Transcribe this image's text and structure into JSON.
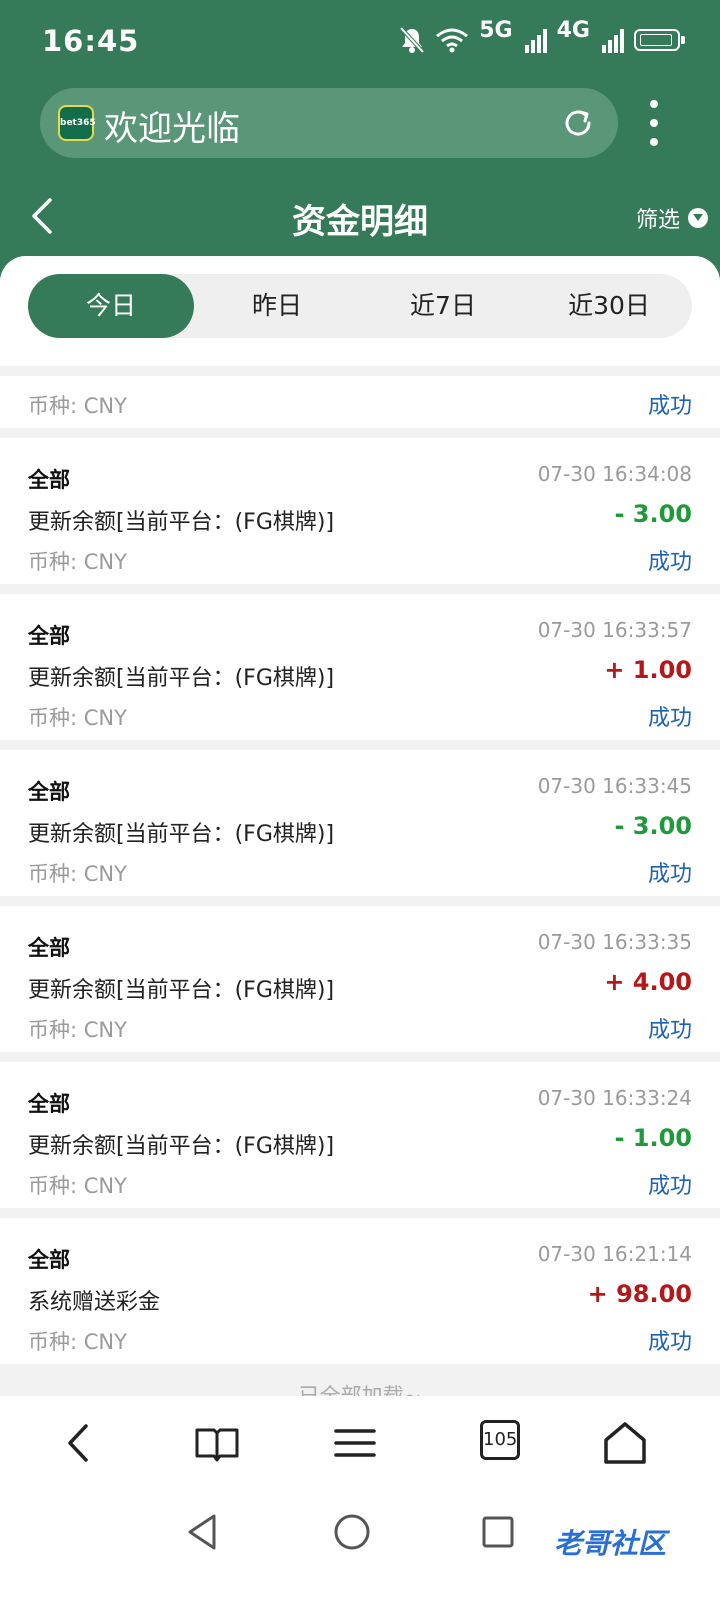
{
  "status_bar": {
    "time": "16:45",
    "net1": "5G",
    "net2": "4G"
  },
  "browser": {
    "site_title": "欢迎光临",
    "logo_text": "bet365",
    "tab_count": "105"
  },
  "header": {
    "title": "资金明细",
    "filter_label": "筛选"
  },
  "tabs": [
    {
      "label": "今日",
      "active": true
    },
    {
      "label": "昨日",
      "active": false
    },
    {
      "label": "近7日",
      "active": false
    },
    {
      "label": "近30日",
      "active": false
    }
  ],
  "partial_row": {
    "currency": "币种: CNY",
    "status": "成功"
  },
  "records": [
    {
      "type": "全部",
      "time": "07-30 16:34:08",
      "desc": "更新余额[当前平台：(FG棋牌)]",
      "amount": "- 3.00",
      "sign": "neg",
      "currency": "币种: CNY",
      "status": "成功"
    },
    {
      "type": "全部",
      "time": "07-30 16:33:57",
      "desc": "更新余额[当前平台：(FG棋牌)]",
      "amount": "+ 1.00",
      "sign": "pos",
      "currency": "币种: CNY",
      "status": "成功"
    },
    {
      "type": "全部",
      "time": "07-30 16:33:45",
      "desc": "更新余额[当前平台：(FG棋牌)]",
      "amount": "- 3.00",
      "sign": "neg",
      "currency": "币种: CNY",
      "status": "成功"
    },
    {
      "type": "全部",
      "time": "07-30 16:33:35",
      "desc": "更新余额[当前平台：(FG棋牌)]",
      "amount": "+ 4.00",
      "sign": "pos",
      "currency": "币种: CNY",
      "status": "成功"
    },
    {
      "type": "全部",
      "time": "07-30 16:33:24",
      "desc": "更新余额[当前平台：(FG棋牌)]",
      "amount": "- 1.00",
      "sign": "neg",
      "currency": "币种: CNY",
      "status": "成功"
    },
    {
      "type": "全部",
      "time": "07-30 16:21:14",
      "desc": "系统赠送彩金",
      "amount": "+ 98.00",
      "sign": "pos",
      "currency": "币种: CNY",
      "status": "成功"
    }
  ],
  "footer_text": "已全部加载~",
  "watermark": "老哥社区",
  "colors": {
    "brand_green": "#367b59",
    "negative": "#1f9a3a",
    "positive": "#b51818",
    "status_blue": "#1e62b5"
  }
}
